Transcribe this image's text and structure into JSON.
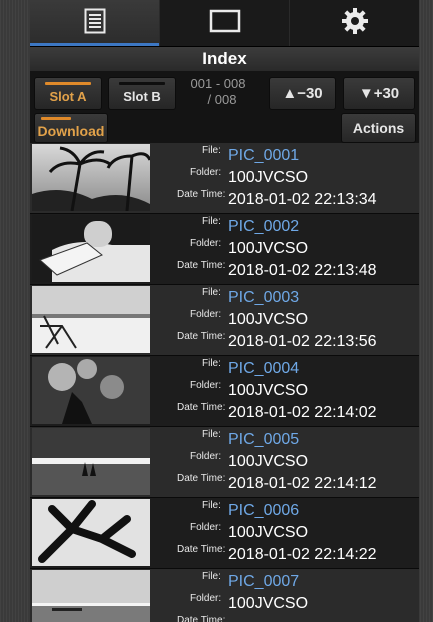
{
  "tabs": [
    {
      "icon": "list-icon",
      "active": true
    },
    {
      "icon": "rectangle-icon",
      "active": false
    },
    {
      "icon": "gear-icon",
      "active": false
    }
  ],
  "header": {
    "title": "Index"
  },
  "slots": {
    "slot_a": {
      "label": "Slot A",
      "selected": true
    },
    "slot_b": {
      "label": "Slot B",
      "selected": false
    }
  },
  "page_indicator": {
    "range": "001 - 008",
    "total": "/ 008"
  },
  "nav": {
    "back": "▲−30",
    "forward": "▼+30"
  },
  "download_label": "Download",
  "actions_label": "Actions",
  "labels": {
    "file": "File:",
    "folder": "Folder:",
    "datetime": "Date Time:"
  },
  "items": [
    {
      "file": "PIC_0001",
      "folder": "100JVCSO",
      "datetime": "2018-01-02 22:13:34",
      "thumb": "palm-trees"
    },
    {
      "file": "PIC_0002",
      "folder": "100JVCSO",
      "datetime": "2018-01-02 22:13:48",
      "thumb": "person-reading"
    },
    {
      "file": "PIC_0003",
      "folder": "100JVCSO",
      "datetime": "2018-01-02 22:13:56",
      "thumb": "beach-chair"
    },
    {
      "file": "PIC_0004",
      "folder": "100JVCSO",
      "datetime": "2018-01-02 22:14:02",
      "thumb": "water-splash"
    },
    {
      "file": "PIC_0005",
      "folder": "100JVCSO",
      "datetime": "2018-01-02 22:14:12",
      "thumb": "couple-sunset"
    },
    {
      "file": "PIC_0006",
      "folder": "100JVCSO",
      "datetime": "2018-01-02 22:14:22",
      "thumb": "leaves"
    },
    {
      "file": "PIC_0007",
      "folder": "100JVCSO",
      "datetime": "",
      "thumb": "figure-shore"
    }
  ]
}
